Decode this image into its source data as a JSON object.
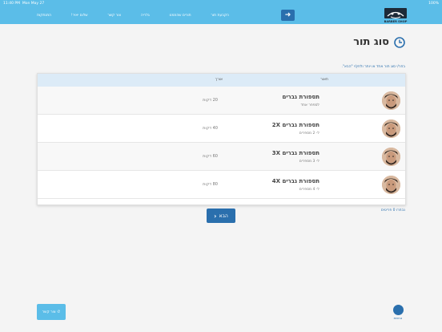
{
  "status_bar": {
    "time": "11:40 PM",
    "date": "Mon May 27",
    "battery": "100%"
  },
  "nav": {
    "items": [
      "הקבעת תור",
      "תורים שהוזמנו",
      "גלריה",
      "צור קשר",
      "שלום יאיר!",
      "התנתקות"
    ]
  },
  "logo": {
    "text": "BARBER SHOP"
  },
  "page": {
    "title": "סוג תור",
    "hint": "בחר/י סוג תור אחד או יותר ולחץ/י \"הבא\".",
    "col_desc": "תאור",
    "col_len": "אורך",
    "count": "נבחרו 0 פריטים",
    "next_label": "הבא"
  },
  "services": [
    {
      "name": "תספורת גברים",
      "sub": "לספפר אחד",
      "duration": "20 דקות"
    },
    {
      "name": "תספורת גברים 2X",
      "sub": "ל- 2 מספרים",
      "duration": "40 דקות"
    },
    {
      "name": "תספורת גברים 3X",
      "sub": "ל- 3 מספרים",
      "duration": "60 דקות"
    },
    {
      "name": "תספורת גברים 4X",
      "sub": "ל- 4 מספרים",
      "duration": "80 דקות"
    }
  ],
  "footer": {
    "call_label": "צור קשר",
    "help_label": "נגישות"
  },
  "colors": {
    "header": "#5bbde8",
    "accent": "#2a6fad",
    "table_header": "#dcebf7"
  }
}
